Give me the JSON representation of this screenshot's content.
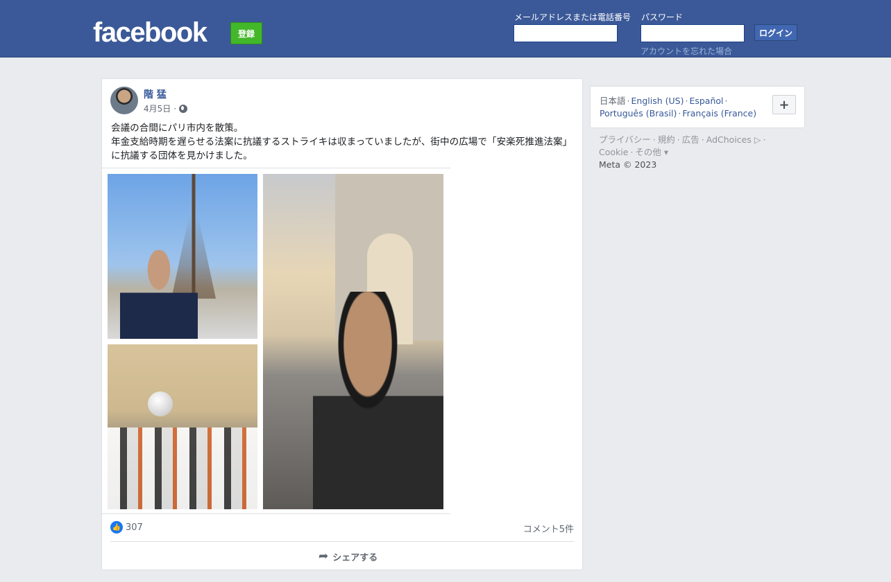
{
  "header": {
    "logo": "facebook",
    "signup_label": "登録",
    "email_label": "メールアドレスまたは電話番号",
    "password_label": "パスワード",
    "login_label": "ログイン",
    "forgot_label": "アカウントを忘れた場合",
    "bg_color": "#3b5998"
  },
  "post": {
    "author": "階 猛",
    "date": "4月5日",
    "privacy_icon": "globe-icon",
    "text_line1": "会議の合間にパリ市内を散策。",
    "text_line2": "年金支給時期を遅らせる法案に抗議するストライキは収まっていましたが、街中の広場で「安楽死推進法案」に抗議する団体を見かけました。",
    "reactions_count": "307",
    "comments_label": "コメント5件",
    "share_label": "シェアする"
  },
  "languages": {
    "current": "日本語",
    "options": [
      "English (US)",
      "Español",
      "Português (Brasil)",
      "Français (France)"
    ],
    "add_label": "+"
  },
  "footer": {
    "links": [
      "プライバシー",
      "規約",
      "広告",
      "AdChoices",
      "Cookie",
      "その他"
    ],
    "copyright": "Meta © 2023"
  }
}
